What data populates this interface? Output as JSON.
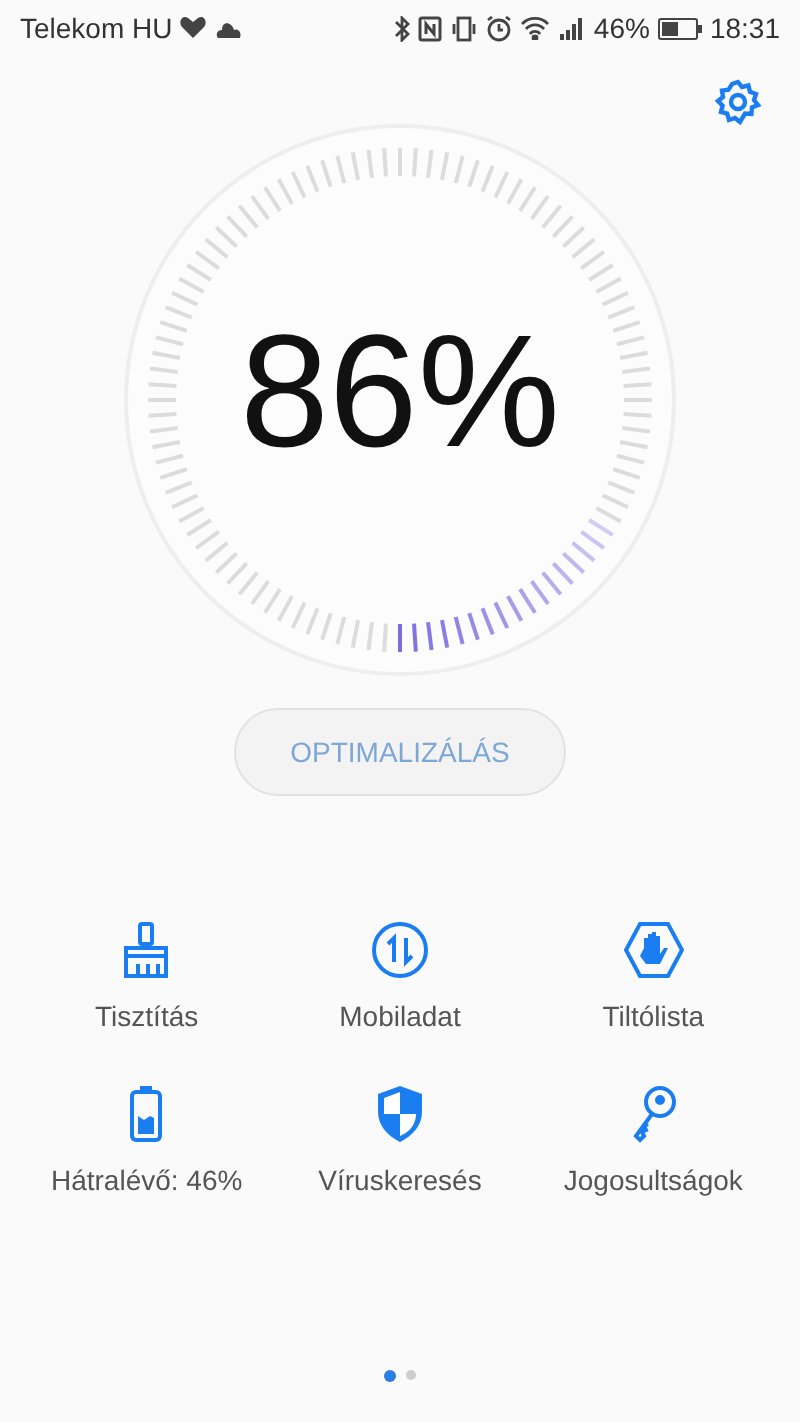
{
  "status_bar": {
    "carrier": "Telekom HU",
    "battery": "46%",
    "time": "18:31"
  },
  "dial": {
    "value": "86%"
  },
  "optimize_button": {
    "label": "OPTIMALIZÁLÁS",
    "disabled": true
  },
  "tools": [
    {
      "label": "Tisztítás"
    },
    {
      "label": "Mobiladat"
    },
    {
      "label": "Tiltólista"
    },
    {
      "label": "Hátralévő: 46%"
    },
    {
      "label": "Víruskeresés"
    },
    {
      "label": "Jogosultságok"
    }
  ],
  "pages": [
    {
      "selected": true
    },
    {
      "selected": false
    }
  ]
}
